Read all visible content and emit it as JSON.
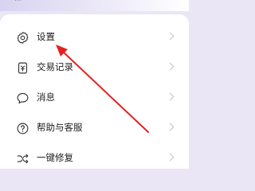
{
  "top": {
    "left_text": "..."
  },
  "menu": {
    "items": [
      {
        "label": "设置",
        "icon": "gear-icon"
      },
      {
        "label": "交易记录",
        "icon": "transaction-record-icon"
      },
      {
        "label": "消息",
        "icon": "message-bubble-icon"
      },
      {
        "label": "帮助与客服",
        "icon": "help-question-icon"
      },
      {
        "label": "一键修复",
        "icon": "shuffle-repair-icon"
      }
    ]
  },
  "annotation": {
    "arrow_color": "#e52222",
    "description": "red arrow pointing to 设置"
  },
  "colors": {
    "background": "#ebe6f5",
    "card": "#ffffff",
    "text": "#1e1e1e",
    "icon": "#333333",
    "chevron": "#c4c4c4"
  }
}
